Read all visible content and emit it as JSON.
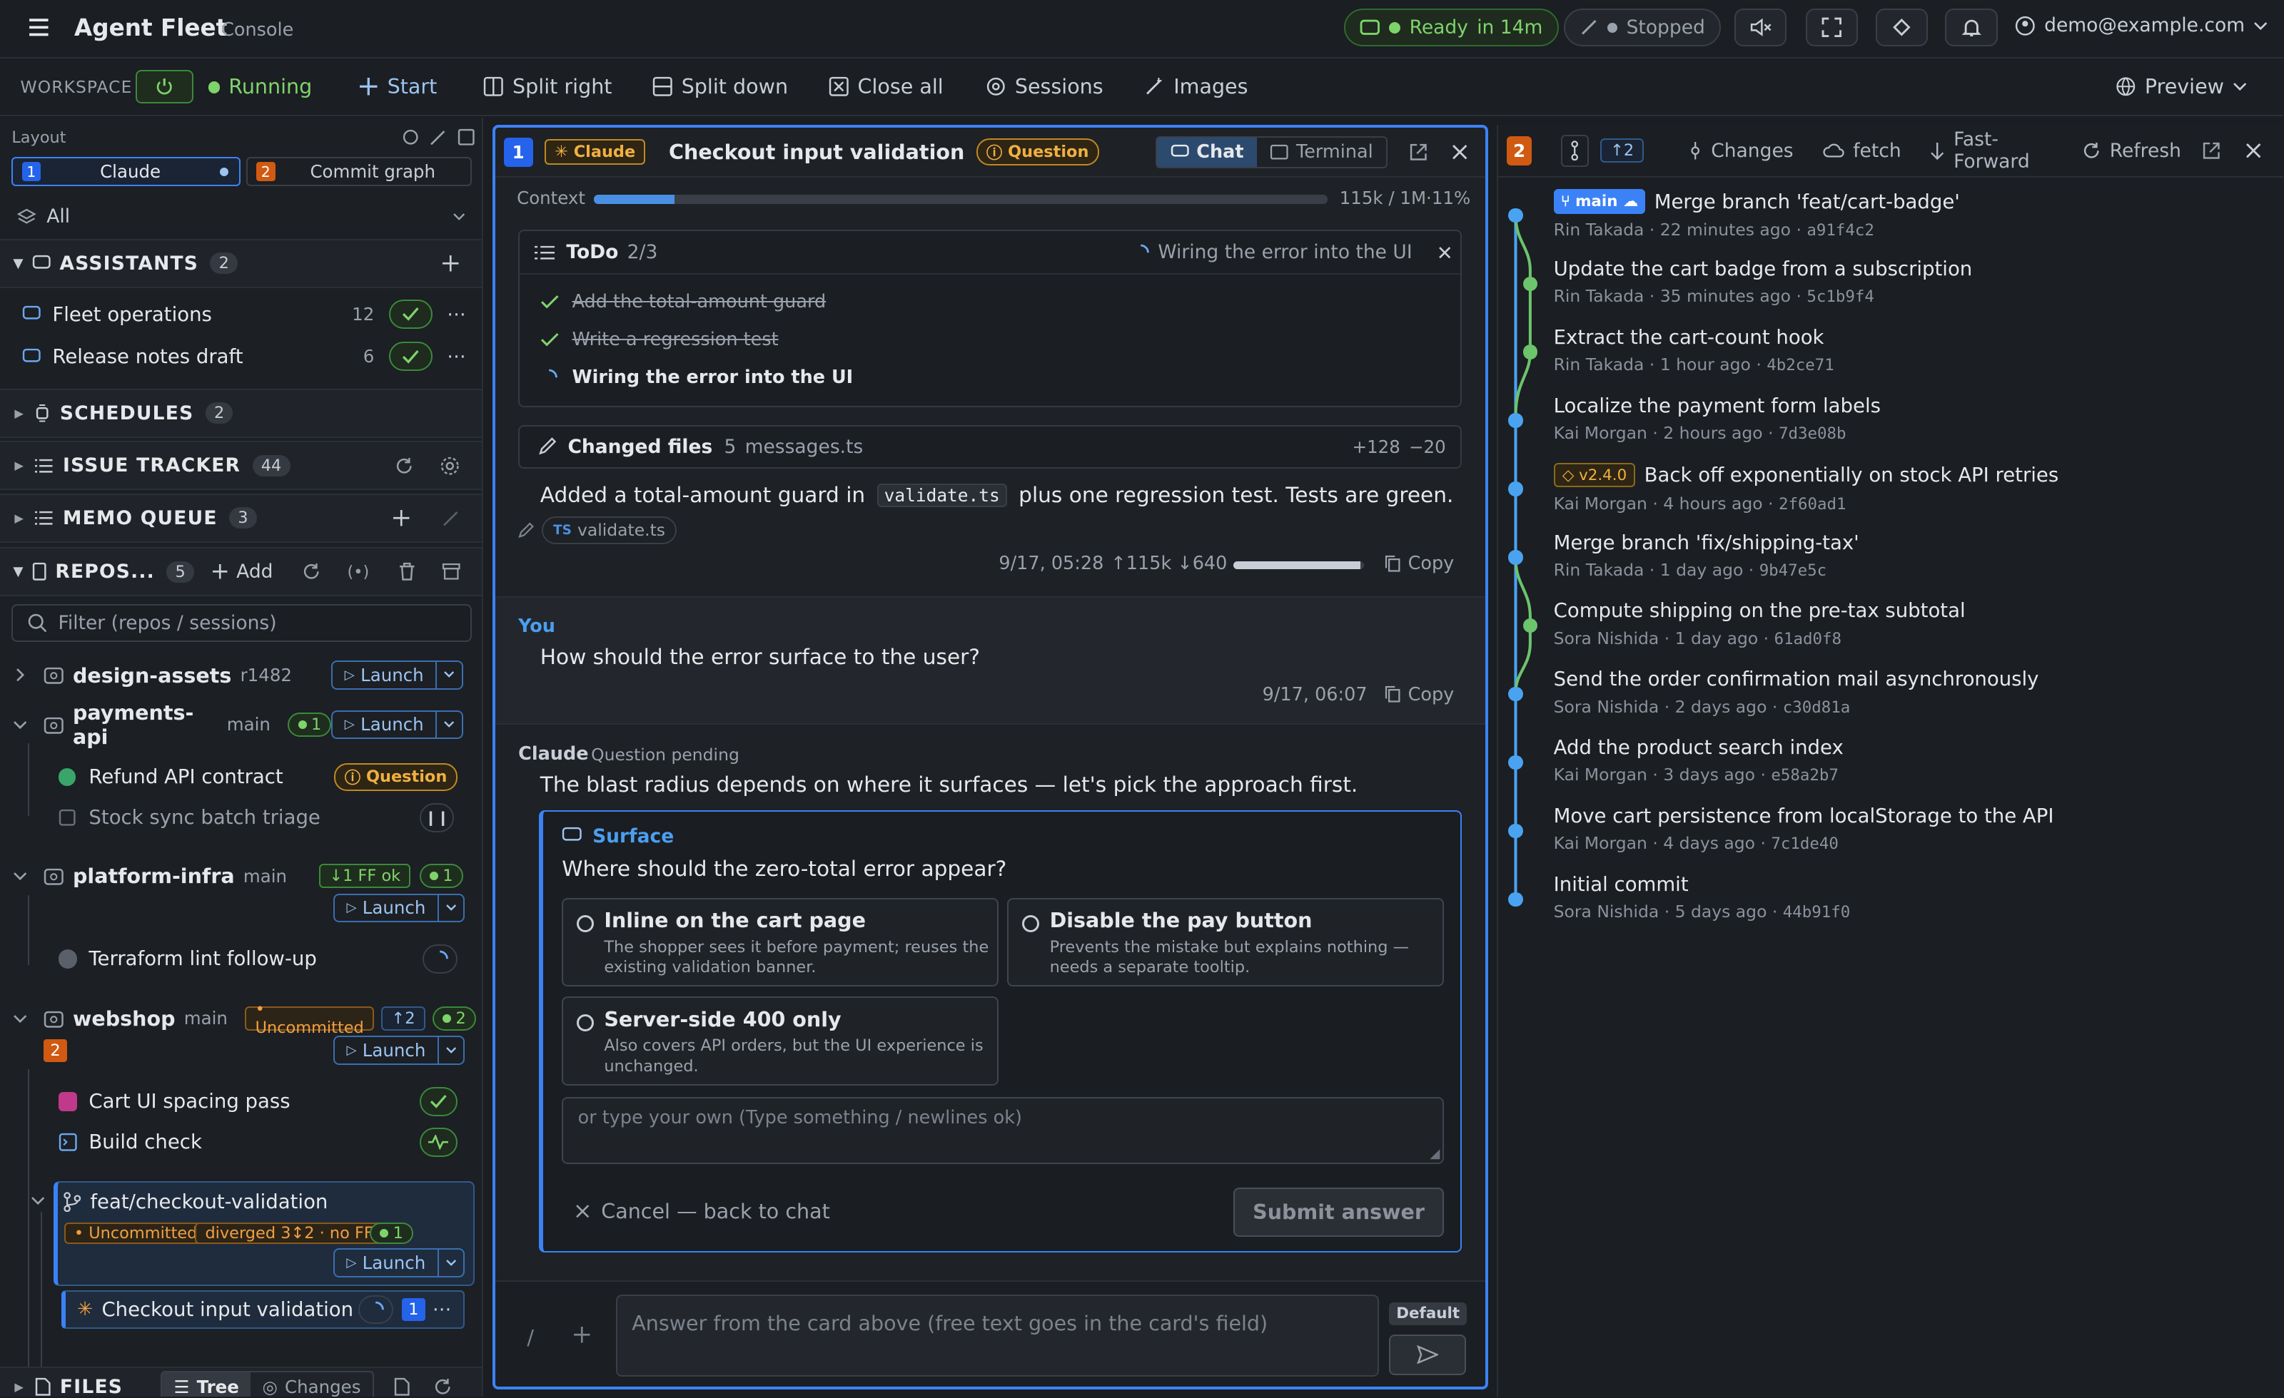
{
  "app": {
    "title": "Agent Fleet",
    "subtitle": "Console"
  },
  "topbar": {
    "ready": "Ready",
    "ready_time": "in 14m",
    "stopped": "Stopped",
    "user": "demo@example.com"
  },
  "subbar": {
    "workspace": "WORKSPACE",
    "running": "Running",
    "items": [
      "Start",
      "Split right",
      "Split down",
      "Close all",
      "Sessions",
      "Images"
    ],
    "preview": "Preview"
  },
  "sidebar": {
    "layout_label": "Layout",
    "tab1_num": "1",
    "tab1": "Claude",
    "tab2_num": "2",
    "tab2": "Commit graph",
    "filter_all": "All",
    "assistants": {
      "title": "ASSISTANTS",
      "count": "2",
      "items": [
        {
          "name": "Fleet operations",
          "count": "12"
        },
        {
          "name": "Release notes draft",
          "count": "6"
        }
      ]
    },
    "schedules": {
      "title": "SCHEDULES",
      "count": "2"
    },
    "issue_tracker": {
      "title": "ISSUE TRACKER",
      "count": "44"
    },
    "memo_queue": {
      "title": "MEMO QUEUE",
      "count": "3"
    },
    "repos": {
      "title": "REPOS...",
      "count": "5",
      "add": "Add",
      "filter_placeholder": "Filter (repos / sessions)"
    },
    "repo_list": [
      {
        "name": "design-assets",
        "branch": "r1482",
        "launch": "Launch"
      },
      {
        "name": "payments-api",
        "branch": "main",
        "sessions": "1",
        "launch": "Launch",
        "children": [
          {
            "name": "Refund API contract",
            "badge": "Question"
          },
          {
            "name": "Stock sync batch triage"
          }
        ]
      },
      {
        "name": "platform-infra",
        "branch": "main",
        "ff": "↓1 FF ok",
        "sessions": "1",
        "launch": "Launch",
        "children": [
          {
            "name": "Terraform lint follow-up"
          }
        ]
      },
      {
        "name": "webshop",
        "branch": "main",
        "uncommitted": "• Uncommitted",
        "ahead": "↑2",
        "sessions": "2",
        "num": "2",
        "launch": "Launch",
        "children": [
          {
            "name": "Cart UI spacing pass"
          },
          {
            "name": "Build check"
          }
        ]
      }
    ],
    "worktree": {
      "name": "feat/checkout-validation",
      "uncommitted": "• Uncommitted",
      "diverged": "diverged 3↕2 · no FF",
      "sessions": "1",
      "launch": "Launch",
      "session": "Checkout input validation",
      "session_num": "1"
    },
    "files": {
      "title": "FILES",
      "tree": "Tree",
      "changes": "Changes"
    }
  },
  "chat": {
    "pane_num": "1",
    "agent": "Claude",
    "title": "Checkout input validation",
    "status": "Question",
    "tabs": [
      "Chat",
      "Terminal"
    ],
    "context_label": "Context",
    "context_value": "115k / 1M·11%",
    "context_fraction": 0.11,
    "todo": {
      "title": "ToDo",
      "progress": "2/3",
      "current": "Wiring the error into the UI",
      "items": [
        {
          "text": "Add the total-amount guard",
          "done": true
        },
        {
          "text": "Write a regression test",
          "done": true
        },
        {
          "text": "Wiring the error into the UI",
          "done": false
        }
      ]
    },
    "changed": {
      "title": "Changed files",
      "count": "5",
      "file": "messages.ts",
      "plus": "+128",
      "minus": "−20"
    },
    "msg1": {
      "pre": "Added a total-amount guard in",
      "code": "validate.ts",
      "post": "plus one regression test. Tests are green.",
      "file_chip": "validate.ts",
      "time": "9/17, 05:28",
      "tokens": "↑115k ↓640",
      "copy": "Copy"
    },
    "msg2": {
      "author": "You",
      "text": "How should the error surface to the user?",
      "time": "9/17, 06:07",
      "copy": "Copy"
    },
    "msg3": {
      "author": "Claude",
      "status": "Question pending",
      "text": "The blast radius depends on where it surfaces — let's pick the approach first."
    },
    "question": {
      "header": "Surface",
      "prompt": "Where should the zero-total error appear?",
      "options": [
        {
          "title": "Inline on the cart page",
          "desc": "The shopper sees it before payment; reuses the existing validation banner."
        },
        {
          "title": "Disable the pay button",
          "desc": "Prevents the mistake but explains nothing — needs a separate tooltip."
        },
        {
          "title": "Server-side 400 only",
          "desc": "Also covers API orders, but the UI experience is unchanged."
        }
      ],
      "custom_placeholder": "or type your own (Type something / newlines ok)",
      "cancel": "Cancel — back to chat",
      "submit": "Submit answer"
    },
    "input": {
      "placeholder": "Answer from the card above (free text goes in the card's field)",
      "mode": "Default",
      "slash": "/"
    }
  },
  "graph": {
    "pane_num": "2",
    "ahead": "↑2",
    "changes": "Changes",
    "fetch": "fetch",
    "ff": "Fast-Forward",
    "refresh": "Refresh",
    "commits": [
      {
        "branch": "main",
        "message": "Merge branch 'feat/cart-badge'",
        "author": "Rin Takada",
        "when": "22 minutes ago",
        "hash": "a91f4c2"
      },
      {
        "message": "Update the cart badge from a subscription",
        "author": "Rin Takada",
        "when": "35 minutes ago",
        "hash": "5c1b9f4"
      },
      {
        "message": "Extract the cart-count hook",
        "author": "Rin Takada",
        "when": "1 hour ago",
        "hash": "4b2ce71"
      },
      {
        "message": "Localize the payment form labels",
        "author": "Kai Morgan",
        "when": "2 hours ago",
        "hash": "7d3e08b"
      },
      {
        "tag": "v2.4.0",
        "message": "Back off exponentially on stock API retries",
        "author": "Kai Morgan",
        "when": "4 hours ago",
        "hash": "2f60ad1"
      },
      {
        "message": "Merge branch 'fix/shipping-tax'",
        "author": "Rin Takada",
        "when": "1 day ago",
        "hash": "9b47e5c"
      },
      {
        "message": "Compute shipping on the pre-tax subtotal",
        "author": "Sora Nishida",
        "when": "1 day ago",
        "hash": "61ad0f8"
      },
      {
        "message": "Send the order confirmation mail asynchronously",
        "author": "Sora Nishida",
        "when": "2 days ago",
        "hash": "c30d81a"
      },
      {
        "message": "Add the product search index",
        "author": "Kai Morgan",
        "when": "3 days ago",
        "hash": "e58a2b7"
      },
      {
        "message": "Move cart persistence from localStorage to the API",
        "author": "Kai Morgan",
        "when": "4 days ago",
        "hash": "7c1de40"
      },
      {
        "message": "Initial commit",
        "author": "Sora Nishida",
        "when": "5 days ago",
        "hash": "44b91f0"
      }
    ]
  },
  "colors": {
    "accent": "#3b82f6",
    "green": "#7fd36b",
    "orange": "#f0a040",
    "graph_blue": "#4aa3f0",
    "graph_green": "#6cc46c"
  }
}
